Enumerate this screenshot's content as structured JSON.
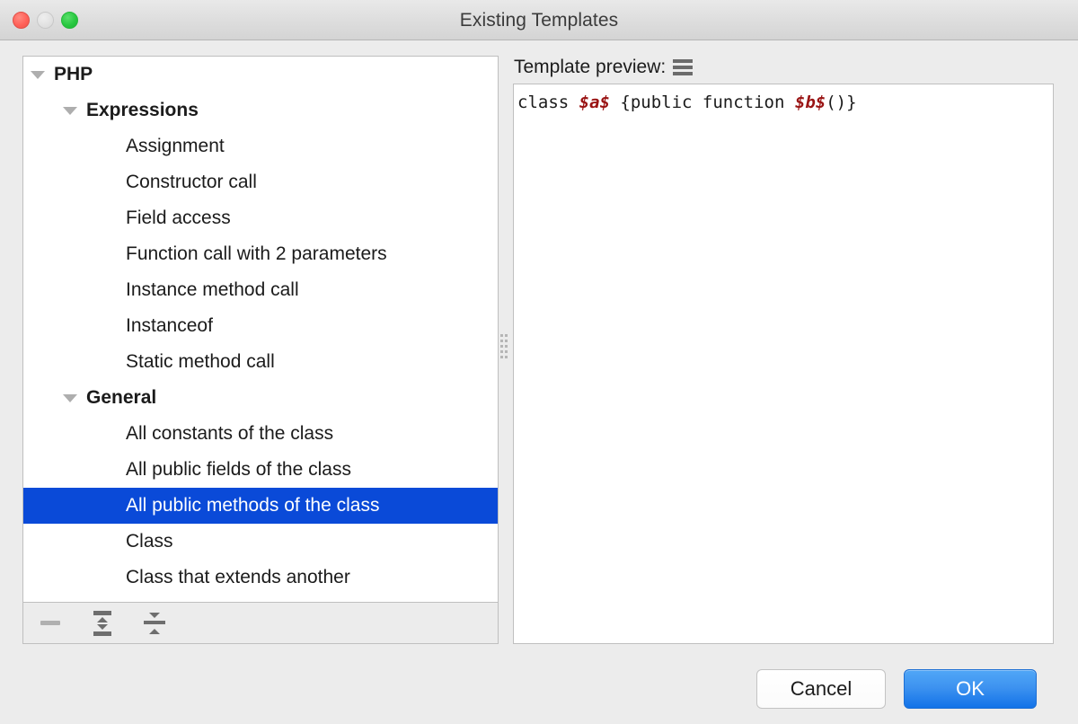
{
  "window": {
    "title": "Existing Templates",
    "traffic_lights": [
      {
        "name": "close-button",
        "color": "#ff6159"
      },
      {
        "name": "minimize-button",
        "color": "#e2e2e2"
      },
      {
        "name": "zoom-button",
        "color": "#28c840"
      }
    ]
  },
  "tree": {
    "nodes": [
      {
        "label": "PHP",
        "level": 0,
        "expanded": true,
        "bold": true,
        "selected": false
      },
      {
        "label": "Expressions",
        "level": 1,
        "expanded": true,
        "bold": true,
        "selected": false
      },
      {
        "label": "Assignment",
        "level": 2,
        "expanded": false,
        "bold": false,
        "selected": false
      },
      {
        "label": "Constructor call",
        "level": 2,
        "expanded": false,
        "bold": false,
        "selected": false
      },
      {
        "label": "Field access",
        "level": 2,
        "expanded": false,
        "bold": false,
        "selected": false
      },
      {
        "label": "Function call with 2 parameters",
        "level": 2,
        "expanded": false,
        "bold": false,
        "selected": false
      },
      {
        "label": "Instance method call",
        "level": 2,
        "expanded": false,
        "bold": false,
        "selected": false
      },
      {
        "label": "Instanceof",
        "level": 2,
        "expanded": false,
        "bold": false,
        "selected": false
      },
      {
        "label": "Static method call",
        "level": 2,
        "expanded": false,
        "bold": false,
        "selected": false
      },
      {
        "label": "General",
        "level": 1,
        "expanded": true,
        "bold": true,
        "selected": false
      },
      {
        "label": "All constants of the class",
        "level": 2,
        "expanded": false,
        "bold": false,
        "selected": false
      },
      {
        "label": "All public fields of the class",
        "level": 2,
        "expanded": false,
        "bold": false,
        "selected": false
      },
      {
        "label": "All public methods of the class",
        "level": 2,
        "expanded": false,
        "bold": false,
        "selected": true
      },
      {
        "label": "Class",
        "level": 2,
        "expanded": false,
        "bold": false,
        "selected": false
      },
      {
        "label": "Class that extends another",
        "level": 2,
        "expanded": false,
        "bold": false,
        "selected": false
      }
    ],
    "selection_color": "#0a4ad8"
  },
  "tree_toolbar": {
    "buttons": [
      {
        "name": "remove-template-button",
        "icon": "minus-icon",
        "enabled": false
      },
      {
        "name": "expand-all-button",
        "icon": "expand-all-icon",
        "enabled": true
      },
      {
        "name": "collapse-all-button",
        "icon": "collapse-all-icon",
        "enabled": true
      }
    ]
  },
  "preview": {
    "header_label": "Template preview:",
    "menu_icon": "hamburger-menu-icon",
    "code": {
      "segments": [
        {
          "text": "class ",
          "kind": "plain"
        },
        {
          "text": "$a$",
          "kind": "variable"
        },
        {
          "text": " {public function ",
          "kind": "plain"
        },
        {
          "text": "$b$",
          "kind": "variable"
        },
        {
          "text": "()}",
          "kind": "plain"
        }
      ],
      "variable_color": "#9a1414"
    }
  },
  "footer": {
    "cancel_label": "Cancel",
    "ok_label": "OK",
    "ok_accent_color": "#1172e8"
  }
}
